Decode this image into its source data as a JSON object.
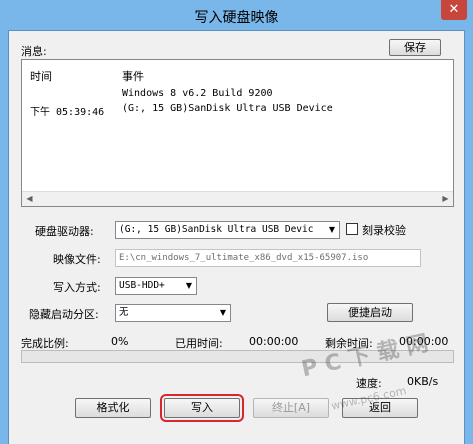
{
  "window": {
    "title": "写入硬盘映像",
    "close_glyph": "✕"
  },
  "messages": {
    "label": "消息:",
    "save_button": "保存",
    "col_time": "时间",
    "col_event": "事件",
    "rows": [
      {
        "time": "",
        "event": "Windows 8 v6.2 Build 9200"
      },
      {
        "time": "下午 05:39:46",
        "event": "(G:, 15 GB)SanDisk Ultra USB Device"
      }
    ]
  },
  "drive": {
    "label": "硬盘驱动器:",
    "value": "(G:, 15 GB)SanDisk Ultra USB Devic",
    "verify_label": "刻录校验",
    "verify_checked": false
  },
  "image_file": {
    "label": "映像文件:",
    "value": "E:\\cn_windows_7_ultimate_x86_dvd_x15-65907.iso"
  },
  "write_mode": {
    "label": "写入方式:",
    "value": "USB-HDD+"
  },
  "hidden_partition": {
    "label": "隐藏启动分区:",
    "value": "无",
    "quick_boot_button": "便捷启动"
  },
  "status": {
    "complete_label": "完成比例:",
    "complete_value": "0%",
    "elapsed_label": "已用时间:",
    "elapsed_value": "00:00:00",
    "remaining_label": "剩余时间:",
    "remaining_value": "00:00:00",
    "speed_label": "速度:",
    "speed_value": "0KB/s",
    "progress_fraction": 0
  },
  "buttons": {
    "format": "格式化",
    "write": "写入",
    "stop": "终止[A]",
    "back": "返回"
  },
  "watermark": {
    "line1": "P C 下 载 网",
    "line2": "www.pc6.com"
  },
  "colors": {
    "title_bar": "#79b7ea",
    "close_button": "#c7463b",
    "highlight_frame": "#d9262a"
  }
}
